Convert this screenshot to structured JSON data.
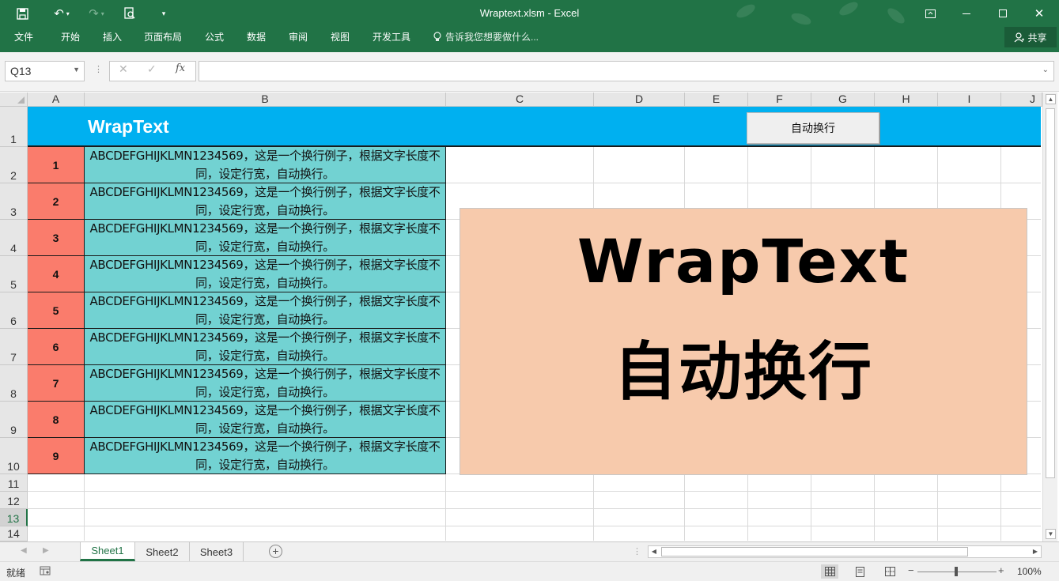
{
  "window": {
    "title": "Wraptext.xlsm - Excel",
    "accent": "#217346"
  },
  "qat": {
    "save_icon": "save-icon",
    "undo_icon": "undo-icon",
    "redo_icon": "redo-icon",
    "preview_icon": "print-preview-icon",
    "customize_icon": "customize-icon"
  },
  "ribbon": {
    "tabs": [
      "文件",
      "开始",
      "插入",
      "页面布局",
      "公式",
      "数据",
      "审阅",
      "视图",
      "开发工具"
    ],
    "tell_me": "告诉我您想要做什么...",
    "share": "共享"
  },
  "formula_bar": {
    "name_box": "Q13",
    "formula": ""
  },
  "columns": [
    "A",
    "B",
    "C",
    "D",
    "E",
    "F",
    "G",
    "H",
    "I",
    "J"
  ],
  "rows": [
    "1",
    "2",
    "3",
    "4",
    "5",
    "6",
    "7",
    "8",
    "9",
    "10",
    "11",
    "12",
    "13",
    "14"
  ],
  "active_row": "13",
  "sheet": {
    "header_title": "WrapText",
    "button_label": "自动换行",
    "data_rows": [
      {
        "num": "1",
        "text": "ABCDEFGHIJKLMN1234569，这是一个换行例子，根据文字长度不同，设定行宽，自动换行。"
      },
      {
        "num": "2",
        "text": "ABCDEFGHIJKLMN1234569，这是一个换行例子，根据文字长度不同，设定行宽，自动换行。"
      },
      {
        "num": "3",
        "text": "ABCDEFGHIJKLMN1234569，这是一个换行例子，根据文字长度不同，设定行宽，自动换行。"
      },
      {
        "num": "4",
        "text": "ABCDEFGHIJKLMN1234569，这是一个换行例子，根据文字长度不同，设定行宽，自动换行。"
      },
      {
        "num": "5",
        "text": "ABCDEFGHIJKLMN1234569，这是一个换行例子，根据文字长度不同，设定行宽，自动换行。"
      },
      {
        "num": "6",
        "text": "ABCDEFGHIJKLMN1234569，这是一个换行例子，根据文字长度不同，设定行宽，自动换行。"
      },
      {
        "num": "7",
        "text": "ABCDEFGHIJKLMN1234569，这是一个换行例子，根据文字长度不同，设定行宽，自动换行。"
      },
      {
        "num": "8",
        "text": "ABCDEFGHIJKLMN1234569，这是一个换行例子，根据文字长度不同，设定行宽，自动换行。"
      },
      {
        "num": "9",
        "text": "ABCDEFGHIJKLMN1234569，这是一个换行例子，根据文字长度不同，设定行宽，自动换行。"
      }
    ],
    "banner_en": "WrapText",
    "banner_zh": "自动换行",
    "colors": {
      "header": "#00b0f0",
      "num_cell": "#fa7c6c",
      "text_cell": "#72d2d2",
      "banner": "#f7caac"
    }
  },
  "sheet_tabs": [
    "Sheet1",
    "Sheet2",
    "Sheet3"
  ],
  "active_sheet": "Sheet1",
  "status": {
    "text": "就绪",
    "zoom": "100%"
  }
}
